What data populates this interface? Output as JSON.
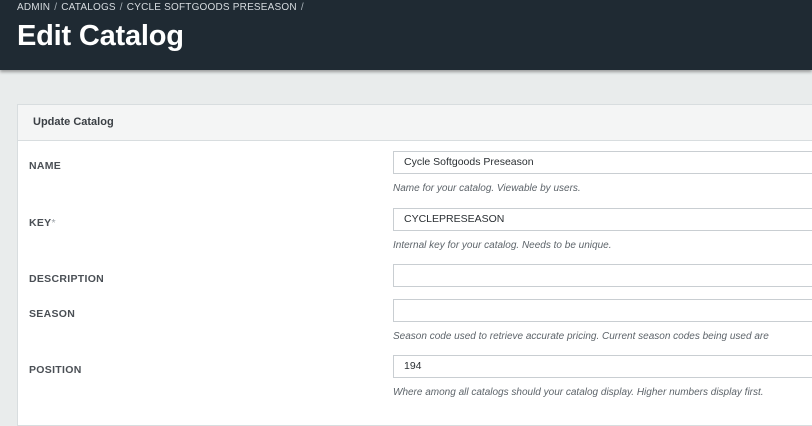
{
  "breadcrumb": {
    "items": [
      "ADMIN",
      "CATALOGS",
      "CYCLE SOFTGOODS PRESEASON"
    ],
    "separator": "/"
  },
  "page": {
    "title": "Edit Catalog"
  },
  "panel": {
    "title": "Update Catalog"
  },
  "form": {
    "name": {
      "label": "NAME",
      "value": "Cycle Softgoods Preseason",
      "help": "Name for your catalog. Viewable by users."
    },
    "key": {
      "label": "KEY",
      "required_mark": "*",
      "value": "CYCLEPRESEASON",
      "help": "Internal key for your catalog. Needs to be unique."
    },
    "description": {
      "label": "DESCRIPTION",
      "value": ""
    },
    "season": {
      "label": "SEASON",
      "value": "",
      "help": "Season code used to retrieve accurate pricing. Current season codes being used are"
    },
    "position": {
      "label": "POSITION",
      "value": "194",
      "help": "Where among all catalogs should your catalog display. Higher numbers display first."
    }
  },
  "colors": {
    "header_bg": "#1f2a33",
    "page_bg": "#e9ecec",
    "panel_bg": "#ffffff"
  }
}
